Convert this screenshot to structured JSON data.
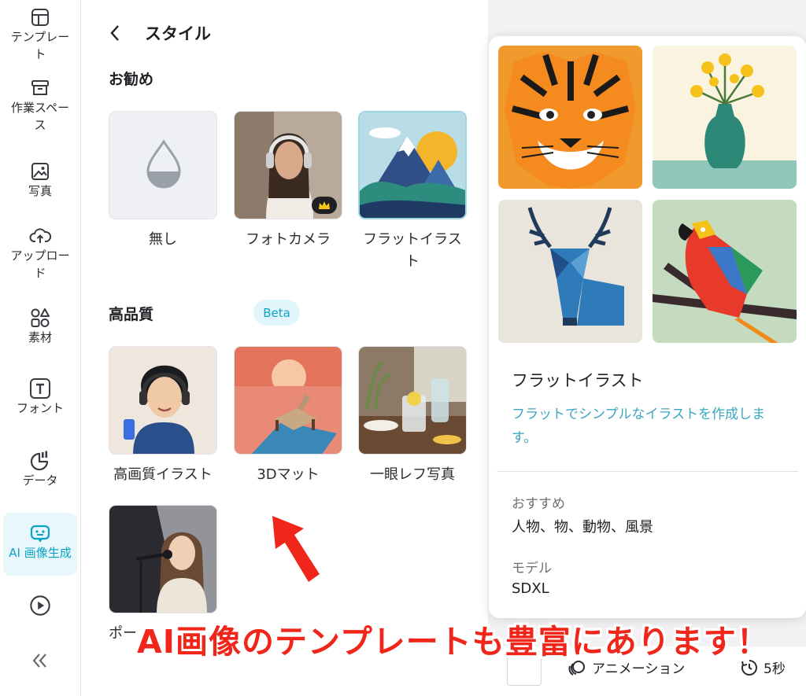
{
  "sidebar": {
    "items": [
      {
        "label": "テンプレート",
        "icon": "layout-template-icon"
      },
      {
        "label": "作業スペース",
        "icon": "archive-box-icon"
      },
      {
        "label": "写真",
        "icon": "image-icon"
      },
      {
        "label": "アップロード",
        "icon": "cloud-upload-icon"
      },
      {
        "label": "素材",
        "icon": "shapes-icon"
      },
      {
        "label": "フォント",
        "icon": "text-t-icon"
      },
      {
        "label": "データ",
        "icon": "pie-chart-icon"
      },
      {
        "label": "AI 画像生成",
        "icon": "ai-robot-icon",
        "active": true
      },
      {
        "label": "",
        "icon": "play-circle-icon"
      },
      {
        "label": "",
        "icon": "collapse-chevrons-icon"
      }
    ]
  },
  "panel": {
    "title": "スタイル",
    "recommended_title": "お勧め",
    "high_quality_title": "高品質",
    "beta_label": "Beta",
    "recommended": [
      {
        "label": "無し",
        "icon": "drop-icon"
      },
      {
        "label": "フォトカメラ",
        "icon": "crown-icon"
      },
      {
        "label": "フラットイラスト"
      }
    ],
    "high_quality": [
      {
        "label": "高画質イラスト"
      },
      {
        "label": "3Dマット"
      },
      {
        "label": "一眼レフ写真"
      },
      {
        "label": "ポー"
      }
    ]
  },
  "preview": {
    "name": "フラットイラスト",
    "description": "フラットでシンプルなイラストを作成します。",
    "recommend_label": "おすすめ",
    "recommend_value": "人物、物、動物、風景",
    "model_label": "モデル",
    "model_value": "SDXL"
  },
  "bottom_bar": {
    "animation_label": "アニメーション",
    "duration_label": "5秒"
  },
  "annotation": "AI画像のテンプレートも豊富にあります！",
  "colors": {
    "accent": "#0aa3c4",
    "annotation": "#f0261b"
  }
}
